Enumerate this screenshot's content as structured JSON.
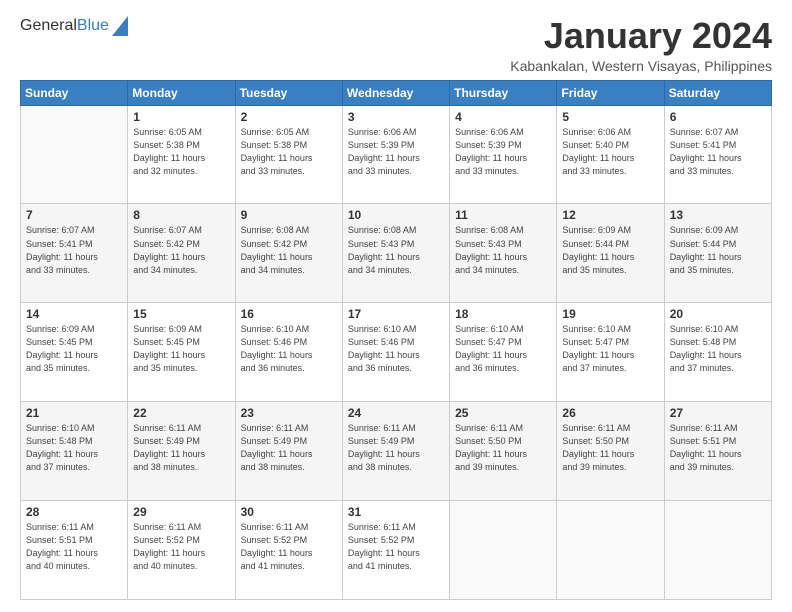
{
  "logo": {
    "general": "General",
    "blue": "Blue"
  },
  "header": {
    "month": "January 2024",
    "location": "Kabankalan, Western Visayas, Philippines"
  },
  "days": [
    "Sunday",
    "Monday",
    "Tuesday",
    "Wednesday",
    "Thursday",
    "Friday",
    "Saturday"
  ],
  "weeks": [
    [
      {
        "num": "",
        "info": ""
      },
      {
        "num": "1",
        "info": "Sunrise: 6:05 AM\nSunset: 5:38 PM\nDaylight: 11 hours\nand 32 minutes."
      },
      {
        "num": "2",
        "info": "Sunrise: 6:05 AM\nSunset: 5:38 PM\nDaylight: 11 hours\nand 33 minutes."
      },
      {
        "num": "3",
        "info": "Sunrise: 6:06 AM\nSunset: 5:39 PM\nDaylight: 11 hours\nand 33 minutes."
      },
      {
        "num": "4",
        "info": "Sunrise: 6:06 AM\nSunset: 5:39 PM\nDaylight: 11 hours\nand 33 minutes."
      },
      {
        "num": "5",
        "info": "Sunrise: 6:06 AM\nSunset: 5:40 PM\nDaylight: 11 hours\nand 33 minutes."
      },
      {
        "num": "6",
        "info": "Sunrise: 6:07 AM\nSunset: 5:41 PM\nDaylight: 11 hours\nand 33 minutes."
      }
    ],
    [
      {
        "num": "7",
        "info": "Sunrise: 6:07 AM\nSunset: 5:41 PM\nDaylight: 11 hours\nand 33 minutes."
      },
      {
        "num": "8",
        "info": "Sunrise: 6:07 AM\nSunset: 5:42 PM\nDaylight: 11 hours\nand 34 minutes."
      },
      {
        "num": "9",
        "info": "Sunrise: 6:08 AM\nSunset: 5:42 PM\nDaylight: 11 hours\nand 34 minutes."
      },
      {
        "num": "10",
        "info": "Sunrise: 6:08 AM\nSunset: 5:43 PM\nDaylight: 11 hours\nand 34 minutes."
      },
      {
        "num": "11",
        "info": "Sunrise: 6:08 AM\nSunset: 5:43 PM\nDaylight: 11 hours\nand 34 minutes."
      },
      {
        "num": "12",
        "info": "Sunrise: 6:09 AM\nSunset: 5:44 PM\nDaylight: 11 hours\nand 35 minutes."
      },
      {
        "num": "13",
        "info": "Sunrise: 6:09 AM\nSunset: 5:44 PM\nDaylight: 11 hours\nand 35 minutes."
      }
    ],
    [
      {
        "num": "14",
        "info": "Sunrise: 6:09 AM\nSunset: 5:45 PM\nDaylight: 11 hours\nand 35 minutes."
      },
      {
        "num": "15",
        "info": "Sunrise: 6:09 AM\nSunset: 5:45 PM\nDaylight: 11 hours\nand 35 minutes."
      },
      {
        "num": "16",
        "info": "Sunrise: 6:10 AM\nSunset: 5:46 PM\nDaylight: 11 hours\nand 36 minutes."
      },
      {
        "num": "17",
        "info": "Sunrise: 6:10 AM\nSunset: 5:46 PM\nDaylight: 11 hours\nand 36 minutes."
      },
      {
        "num": "18",
        "info": "Sunrise: 6:10 AM\nSunset: 5:47 PM\nDaylight: 11 hours\nand 36 minutes."
      },
      {
        "num": "19",
        "info": "Sunrise: 6:10 AM\nSunset: 5:47 PM\nDaylight: 11 hours\nand 37 minutes."
      },
      {
        "num": "20",
        "info": "Sunrise: 6:10 AM\nSunset: 5:48 PM\nDaylight: 11 hours\nand 37 minutes."
      }
    ],
    [
      {
        "num": "21",
        "info": "Sunrise: 6:10 AM\nSunset: 5:48 PM\nDaylight: 11 hours\nand 37 minutes."
      },
      {
        "num": "22",
        "info": "Sunrise: 6:11 AM\nSunset: 5:49 PM\nDaylight: 11 hours\nand 38 minutes."
      },
      {
        "num": "23",
        "info": "Sunrise: 6:11 AM\nSunset: 5:49 PM\nDaylight: 11 hours\nand 38 minutes."
      },
      {
        "num": "24",
        "info": "Sunrise: 6:11 AM\nSunset: 5:49 PM\nDaylight: 11 hours\nand 38 minutes."
      },
      {
        "num": "25",
        "info": "Sunrise: 6:11 AM\nSunset: 5:50 PM\nDaylight: 11 hours\nand 39 minutes."
      },
      {
        "num": "26",
        "info": "Sunrise: 6:11 AM\nSunset: 5:50 PM\nDaylight: 11 hours\nand 39 minutes."
      },
      {
        "num": "27",
        "info": "Sunrise: 6:11 AM\nSunset: 5:51 PM\nDaylight: 11 hours\nand 39 minutes."
      }
    ],
    [
      {
        "num": "28",
        "info": "Sunrise: 6:11 AM\nSunset: 5:51 PM\nDaylight: 11 hours\nand 40 minutes."
      },
      {
        "num": "29",
        "info": "Sunrise: 6:11 AM\nSunset: 5:52 PM\nDaylight: 11 hours\nand 40 minutes."
      },
      {
        "num": "30",
        "info": "Sunrise: 6:11 AM\nSunset: 5:52 PM\nDaylight: 11 hours\nand 41 minutes."
      },
      {
        "num": "31",
        "info": "Sunrise: 6:11 AM\nSunset: 5:52 PM\nDaylight: 11 hours\nand 41 minutes."
      },
      {
        "num": "",
        "info": ""
      },
      {
        "num": "",
        "info": ""
      },
      {
        "num": "",
        "info": ""
      }
    ]
  ]
}
